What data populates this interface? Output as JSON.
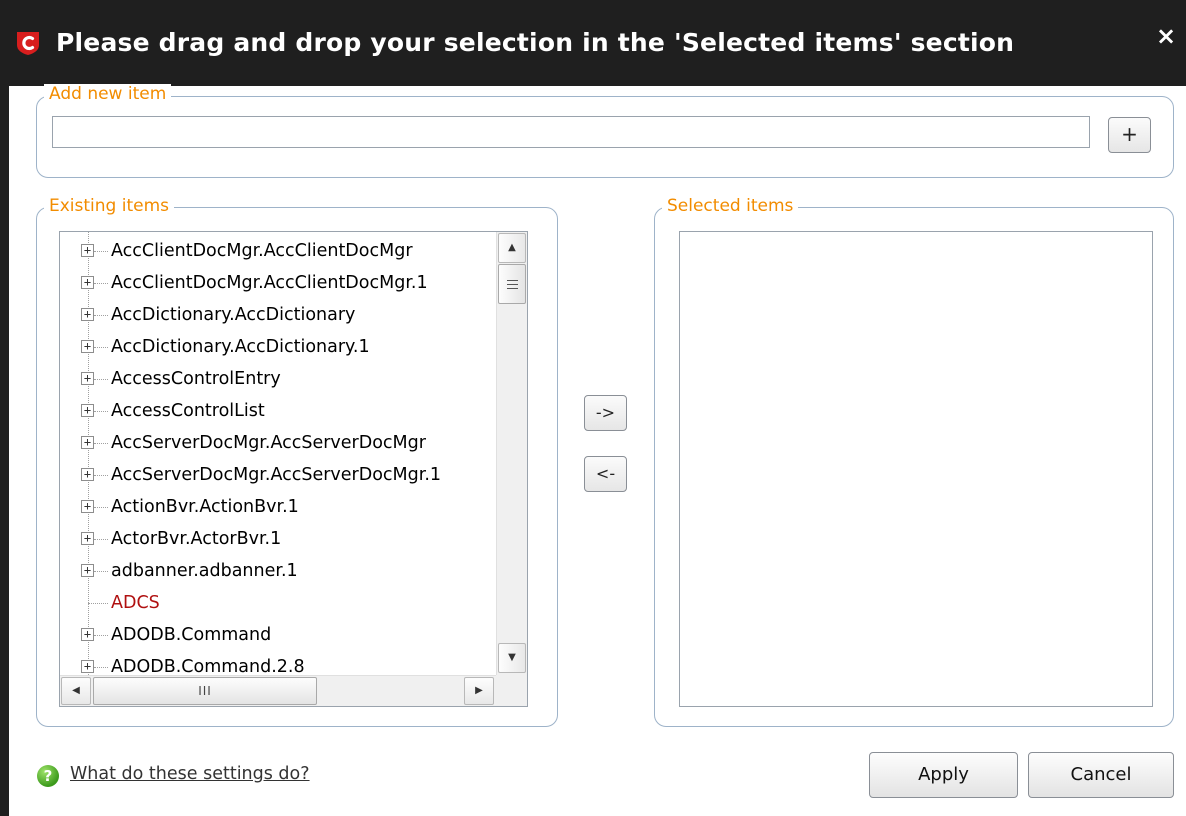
{
  "window": {
    "title": "Please drag and drop your selection in the 'Selected items' section",
    "close_glyph": "×",
    "logo_icon": "comodo-c-logo-icon"
  },
  "add_section": {
    "legend": "Add new item",
    "input_value": "",
    "add_button": "+"
  },
  "existing": {
    "legend": "Existing items",
    "items": [
      {
        "label": "AccClientDocMgr.AccClientDocMgr",
        "expandable": true
      },
      {
        "label": "AccClientDocMgr.AccClientDocMgr.1",
        "expandable": true
      },
      {
        "label": "AccDictionary.AccDictionary",
        "expandable": true
      },
      {
        "label": "AccDictionary.AccDictionary.1",
        "expandable": true
      },
      {
        "label": "AccessControlEntry",
        "expandable": true
      },
      {
        "label": "AccessControlList",
        "expandable": true
      },
      {
        "label": "AccServerDocMgr.AccServerDocMgr",
        "expandable": true
      },
      {
        "label": "AccServerDocMgr.AccServerDocMgr.1",
        "expandable": true
      },
      {
        "label": "ActionBvr.ActionBvr.1",
        "expandable": true
      },
      {
        "label": "ActorBvr.ActorBvr.1",
        "expandable": true
      },
      {
        "label": "adbanner.adbanner.1",
        "expandable": true
      },
      {
        "label": "ADCS",
        "expandable": false,
        "highlight": true
      },
      {
        "label": "ADODB.Command",
        "expandable": true
      },
      {
        "label": "ADODB.Command.2.8",
        "expandable": true
      }
    ],
    "expander_glyph": "+",
    "scroll_up_glyph": "▲",
    "scroll_down_glyph": "▼",
    "scroll_left_glyph": "◀",
    "scroll_right_glyph": "▶",
    "hthumb_glyph": "III"
  },
  "move": {
    "add_label": "->",
    "remove_label": "<-"
  },
  "selected": {
    "legend": "Selected items",
    "items": []
  },
  "footer": {
    "help_icon": "help-question-icon",
    "help_glyph": "?",
    "help_link": "What do these settings do?",
    "apply": "Apply",
    "cancel": "Cancel"
  },
  "colors": {
    "title_bar": "#1f1f1f",
    "legend_text": "#f28c00",
    "group_border": "#9eb3c9",
    "highlight_item": "#b01010",
    "logo_red": "#d81e1e"
  }
}
